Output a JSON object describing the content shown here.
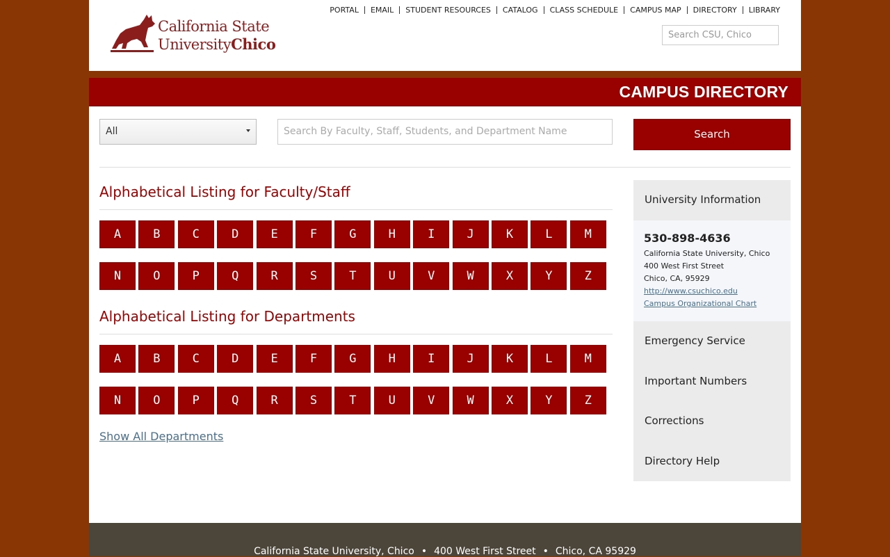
{
  "header": {
    "logo_line1": "California State",
    "logo_line2_a": "University",
    "logo_line2_b": "Chico",
    "utility_nav": [
      "PORTAL",
      "EMAIL",
      "STUDENT RESOURCES",
      "CATALOG",
      "CLASS SCHEDULE",
      "CAMPUS MAP",
      "DIRECTORY",
      "LIBRARY"
    ],
    "search_placeholder": "Search CSU, Chico"
  },
  "banner": {
    "title": "CAMPUS DIRECTORY"
  },
  "search": {
    "filter_value": "All",
    "query_placeholder": "Search By Faculty, Staff, Students, and Department Name",
    "button_label": "Search"
  },
  "faculty": {
    "title": "Alphabetical Listing for Faculty/Staff",
    "letters": [
      "A",
      "B",
      "C",
      "D",
      "E",
      "F",
      "G",
      "H",
      "I",
      "J",
      "K",
      "L",
      "M",
      "N",
      "O",
      "P",
      "Q",
      "R",
      "S",
      "T",
      "U",
      "V",
      "W",
      "X",
      "Y",
      "Z"
    ]
  },
  "departments": {
    "title": "Alphabetical Listing for Departments",
    "letters": [
      "A",
      "B",
      "C",
      "D",
      "E",
      "F",
      "G",
      "H",
      "I",
      "J",
      "K",
      "L",
      "M",
      "N",
      "O",
      "P",
      "Q",
      "R",
      "S",
      "T",
      "U",
      "V",
      "W",
      "X",
      "Y",
      "Z"
    ],
    "show_all": "Show All Departments"
  },
  "sidebar": {
    "university_information": "University Information",
    "phone": "530-898-4636",
    "address_line1": "California State University, Chico",
    "address_line2": "400 West First Street",
    "address_line3": "Chico, CA, 95929",
    "website": "http://www.csuchico.edu",
    "org_chart": "Campus Organizational Chart",
    "emergency": "Emergency Service",
    "important_numbers": "Important Numbers",
    "corrections": "Corrections",
    "directory_help": "Directory Help"
  },
  "footer": {
    "name": "California State University, Chico",
    "street": "400 West First Street",
    "city": "Chico, CA 95929",
    "separator": "•"
  },
  "colors": {
    "brand_red": "#990000",
    "outer_bg": "#8a3604",
    "footer_bg": "#4c463a"
  }
}
